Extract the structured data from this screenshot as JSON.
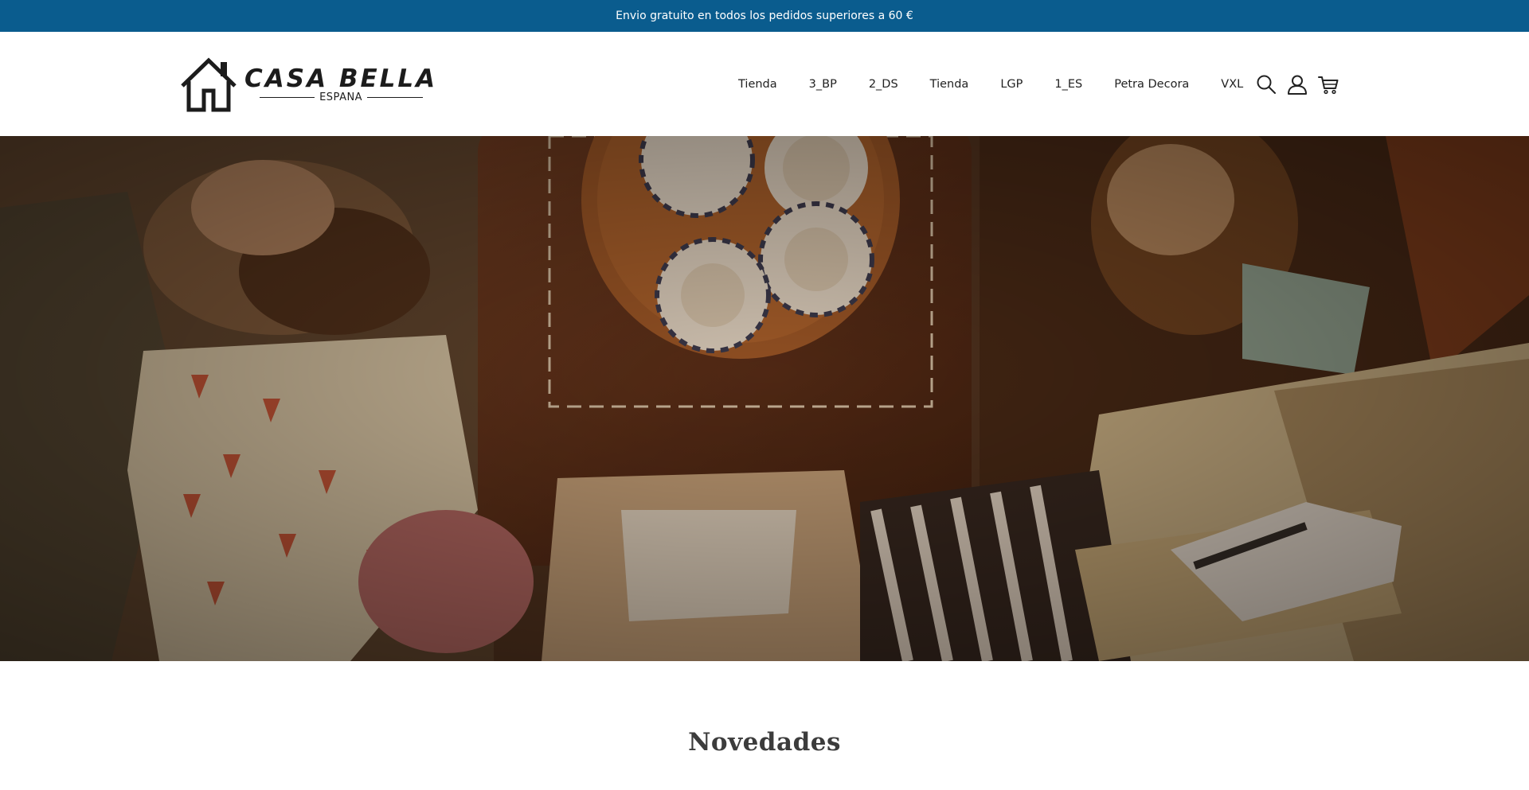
{
  "announcement": {
    "text": "Envio gratuito en todos los pedidos superiores a 60 €",
    "background": "#0a5c8e"
  },
  "header": {
    "logo": {
      "title": "CASA BELLA",
      "subtitle": "ESPANA"
    },
    "nav": [
      {
        "label": "Tienda"
      },
      {
        "label": "3_BP"
      },
      {
        "label": "2_DS"
      },
      {
        "label": "Tienda"
      },
      {
        "label": "LGP"
      },
      {
        "label": "1_ES"
      },
      {
        "label": "Petra Decora"
      },
      {
        "label": "VXL"
      }
    ],
    "icons": [
      "search-icon",
      "account-icon",
      "cart-icon"
    ]
  },
  "hero": {
    "image": "overhead-living-room-photo"
  },
  "sections": {
    "new_arrivals_title": "Novedades"
  }
}
